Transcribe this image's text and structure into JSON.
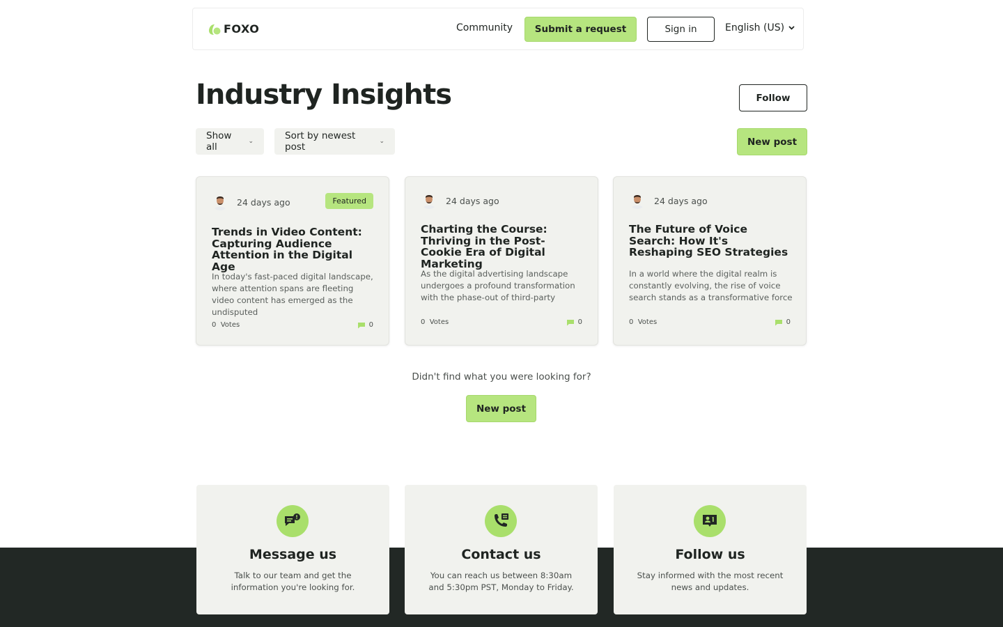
{
  "header": {
    "logo_text": "FOXO",
    "community": "Community",
    "submit_request": "Submit a request",
    "sign_in": "Sign in",
    "language": "English (US)"
  },
  "page": {
    "title": "Industry Insights",
    "follow": "Follow",
    "filter_show": "Show all",
    "filter_sort": "Sort by newest post",
    "new_post": "New post"
  },
  "posts": [
    {
      "time": "24 days ago",
      "badge": "Featured",
      "title": "Trends in Video Content: Capturing Audience Attention in the Digital Age",
      "excerpt": "In today's fast-paced digital landscape, where attention spans are fleeting video content has emerged as the undisputed",
      "votes_count": "0",
      "votes_label": "Votes",
      "comments": "0"
    },
    {
      "time": "24 days ago",
      "title": "Charting the Course: Thriving in the Post-Cookie Era of Digital Marketing",
      "excerpt": "As the digital advertising landscape undergoes a profound transformation with the phase-out of third-party",
      "votes_count": "0",
      "votes_label": "Votes",
      "comments": "0"
    },
    {
      "time": "24 days ago",
      "title": "The Future of Voice Search: How It's Reshaping SEO Strategies",
      "excerpt": "In a world where the digital realm is constantly evolving, the rise of voice search stands as a transformative force",
      "votes_count": "0",
      "votes_label": "Votes",
      "comments": "0"
    }
  ],
  "not_found": {
    "text": "Didn't find what you were looking for?",
    "new_post": "New post"
  },
  "info_cards": [
    {
      "icon": "message-icon",
      "title": "Message us",
      "text": "Talk to our team and get the information you're looking for."
    },
    {
      "icon": "phone-icon",
      "title": "Contact us",
      "text": "You can reach us between 8:30am and 5:30pm PST, Monday to Friday."
    },
    {
      "icon": "follow-icon",
      "title": "Follow us",
      "text": "Stay informed with the most recent news and updates."
    }
  ],
  "colors": {
    "accent": "#b6e57f",
    "dark": "#222825",
    "card_bg": "#f1f2ee"
  }
}
